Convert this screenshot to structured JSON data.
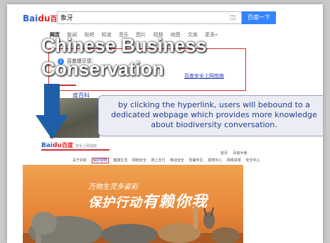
{
  "title": "Chinese Business Conservation",
  "search": {
    "logo_prefix": "Bai",
    "logo_du": "du",
    "logo_cn": "百度",
    "query": "象牙",
    "button": "百度一下"
  },
  "nav": {
    "tabs": [
      "网页",
      "新闻",
      "贴吧",
      "知道",
      "音乐",
      "图片",
      "视频",
      "地图",
      "文库",
      "更多»"
    ],
    "active": "网页"
  },
  "tip": {
    "icon": "info-icon",
    "label": "百度提示您：",
    "link": "百度安全上网指南"
  },
  "result": {
    "baike": "度百科"
  },
  "callout": {
    "text": "by clicking the hyperlink, users will bebound to a dedicated webpage which provides more knowledge about biodiversity conversation."
  },
  "second_page": {
    "logo_prefix": "Bai",
    "logo_du": "du",
    "logo_cn": "百度",
    "logo_sub": "安全上网指南",
    "top_links": [
      "首页",
      "百度手册"
    ],
    "categories": [
      "关于护航",
      "保护动物",
      "健康生活",
      "网络安全",
      "网上支付",
      "移动安全",
      "防骗专区",
      "案例中心",
      "网络举报",
      "安全中心"
    ],
    "highlight_index": 1,
    "banner_line1": "万物生灵多姿彩",
    "banner_line2a": "保护行动",
    "banner_line2b": "有赖你我"
  },
  "colors": {
    "accent_blue": "#3385ff",
    "highlight_red": "#d53030",
    "banner_orange": "#e8873a",
    "callout_text": "#1f3d8c"
  }
}
